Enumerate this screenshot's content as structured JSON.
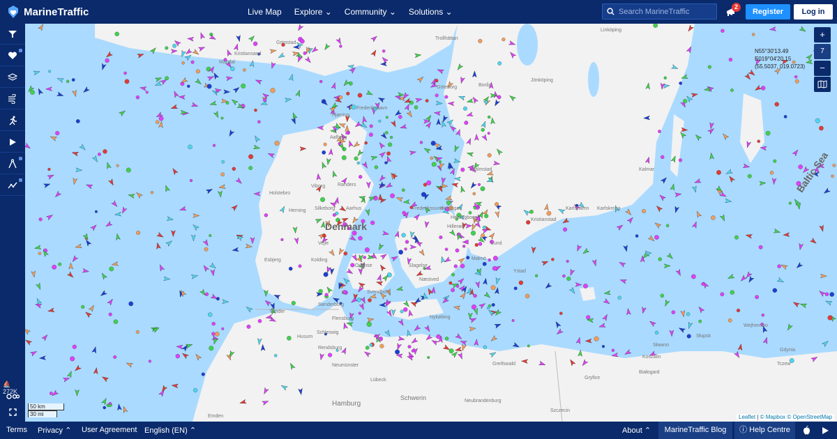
{
  "header": {
    "brand": "MarineTraffic",
    "nav": [
      "Live Map",
      "Explore",
      "Community",
      "Solutions"
    ],
    "search_placeholder": "Search MarineTraffic",
    "notification_count": "2",
    "register_label": "Register",
    "login_label": "Log in"
  },
  "sidebar": {
    "icons": [
      "filter-icon",
      "heart-icon",
      "layers-icon",
      "wind-icon",
      "running-person-icon",
      "play-icon",
      "compass-icon",
      "trend-icon"
    ],
    "ship_count": "272K",
    "extras": [
      "link-icon",
      "fullscreen-icon"
    ]
  },
  "map": {
    "zoom_in": "+",
    "zoom_level": "7",
    "zoom_out": "−",
    "coordinates": {
      "lat": "N55°30'13.49",
      "lon": "E019°04'20.15",
      "decimal": "(55.5037, 019.0723)"
    },
    "scale": [
      "50 km",
      "30 mi"
    ],
    "labels": {
      "country": "Denmark",
      "sea": "Baltic Sea",
      "cities": [
        "Aalborg",
        "Aarhus",
        "Odense",
        "Vejle",
        "Herning",
        "Viborg",
        "Randers",
        "Silkeborg",
        "Holstebro",
        "Esbjerg",
        "Kolding",
        "Sønderborg",
        "Flensburg",
        "Schleswig",
        "Rendsburg",
        "Neumünster",
        "Lübeck",
        "Hamburg",
        "Schwerin",
        "Neubrandenburg",
        "Szczecin",
        "Halmstad",
        "Helsingborg",
        "Lund",
        "Malmö",
        "Kristianstad",
        "Karlskrona",
        "Karlshamn",
        "Kalmar",
        "Jönköping",
        "Borås",
        "Trollhättan",
        "Göteborg",
        "Linköping",
        "Greifswald",
        "Koszalin",
        "Słupsk",
        "Gdynia",
        "Wejherowo",
        "Tczew",
        "Hillerød",
        "Næstved",
        "Slagelse",
        "Svendborg",
        "Frederikshavn",
        "Hjørring",
        "Kristiansand",
        "Mandal",
        "Grimstad",
        "Emden",
        "Husum",
        "Tønder",
        "Nykøbing",
        "Białogard",
        "Sławno",
        "Gryfice",
        "Frederikssund",
        "Helsingør",
        "Ystad"
      ]
    },
    "attribution": {
      "leaflet": "Leaflet",
      "mapbox": "© Mapbox",
      "osm": "© OpenStreetMap"
    }
  },
  "footer": {
    "terms": "Terms",
    "privacy": "Privacy",
    "user_agreement": "User Agreement",
    "language": "English (EN)",
    "about": "About",
    "blog": "MarineTraffic Blog",
    "help": "Help Centre"
  },
  "colors": {
    "brand_navy": "#0a2a6b",
    "register_blue": "#1e90ff",
    "sea": "#aadaff",
    "land": "#f2f2f2",
    "vessel_magenta": "#e040fb",
    "vessel_green": "#3fd24c",
    "vessel_red": "#e53935",
    "vessel_cyan": "#4dd6f0",
    "vessel_orange": "#f39c5a",
    "vessel_blue": "#1c3fd6"
  }
}
